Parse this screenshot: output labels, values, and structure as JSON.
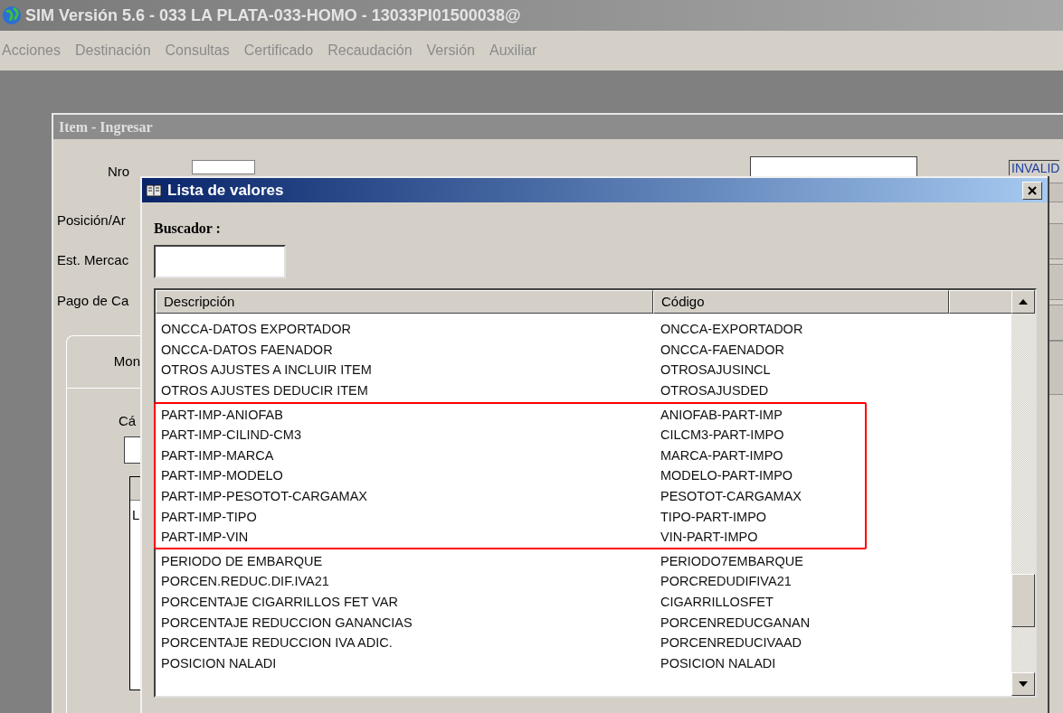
{
  "window": {
    "title": "SIM Versión 5.6 - 033 LA PLATA-033-HOMO - 13033PI01500038@"
  },
  "menu": [
    "Acciones",
    "Destinación",
    "Consultas",
    "Certificado",
    "Recaudación",
    "Versión",
    "Auxiliar"
  ],
  "background_form": {
    "title": "Item - Ingresar",
    "labels": [
      "Nro",
      "Posición/Ar",
      "Est. Mercac",
      "Pago de Ca"
    ],
    "tab_label": "Mon",
    "inner_label": "Cá",
    "list_text": "L",
    "status_value": "INVALID"
  },
  "dialog": {
    "title": "Lista de valores",
    "search": {
      "label": "Buscador :"
    },
    "table": {
      "columns": [
        "Descripción",
        "Código"
      ],
      "row_groups": [
        {
          "highlighted": false,
          "rows": [
            {
              "description": "ONCCA-DATOS EXPORTADOR",
              "code": "ONCCA-EXPORTADOR"
            },
            {
              "description": "ONCCA-DATOS FAENADOR",
              "code": "ONCCA-FAENADOR"
            },
            {
              "description": "OTROS AJUSTES A INCLUIR ITEM",
              "code": "OTROSAJUSINCL"
            },
            {
              "description": "OTROS AJUSTES DEDUCIR ITEM",
              "code": "OTROSAJUSDED"
            }
          ]
        },
        {
          "highlighted": true,
          "rows": [
            {
              "description": "PART-IMP-ANIOFAB",
              "code": "ANIOFAB-PART-IMP"
            },
            {
              "description": "PART-IMP-CILIND-CM3",
              "code": "CILCM3-PART-IMPO"
            },
            {
              "description": "PART-IMP-MARCA",
              "code": "MARCA-PART-IMPO"
            },
            {
              "description": "PART-IMP-MODELO",
              "code": "MODELO-PART-IMPO"
            },
            {
              "description": "PART-IMP-PESOTOT-CARGAMAX",
              "code": "PESOTOT-CARGAMAX"
            },
            {
              "description": "PART-IMP-TIPO",
              "code": "TIPO-PART-IMPO"
            },
            {
              "description": "PART-IMP-VIN",
              "code": "VIN-PART-IMPO"
            }
          ]
        },
        {
          "highlighted": false,
          "rows": [
            {
              "description": "PERIODO DE EMBARQUE",
              "code": "PERIODO7EMBARQUE"
            },
            {
              "description": "PORCEN.REDUC.DIF.IVA21",
              "code": "PORCREDUDIFIVA21"
            },
            {
              "description": "PORCENTAJE CIGARRILLOS FET VAR",
              "code": "CIGARRILLOSFET"
            },
            {
              "description": "PORCENTAJE REDUCCION GANANCIAS",
              "code": "PORCENREDUCGANAN"
            },
            {
              "description": "PORCENTAJE REDUCCION IVA ADIC.",
              "code": "PORCENREDUCIVAAD"
            },
            {
              "description": "POSICION NALADI",
              "code": "POSICION NALADI"
            }
          ]
        }
      ]
    }
  }
}
